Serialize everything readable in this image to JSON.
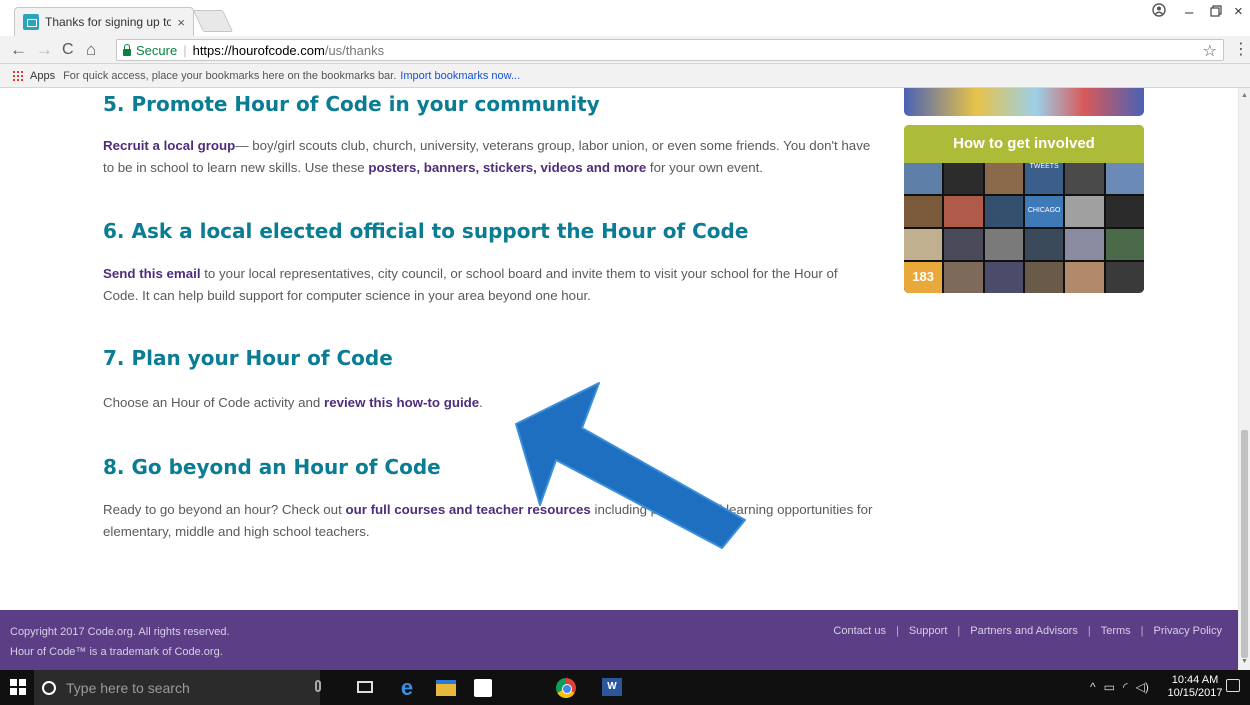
{
  "browser": {
    "tab_title": "Thanks for signing up to",
    "tab_close": "×",
    "omnibox": {
      "secure_label": "Secure",
      "url_host": "https://hourofcode.com",
      "url_path": "/us/thanks"
    },
    "bookmarks_bar": {
      "apps_label": "Apps",
      "hint_text": "For quick access, place your bookmarks here on the bookmarks bar.",
      "import_link": "Import bookmarks now..."
    }
  },
  "steps": [
    {
      "heading": "5. Promote Hour of Code in your community",
      "parts": [
        {
          "t": "Recruit a local group",
          "b": true
        },
        {
          "t": "— boy/girl scouts club, church, university, veterans group, labor union, or even some friends. You don't have to be in school to learn new skills. Use these ",
          "b": false
        },
        {
          "t": "posters, banners, stickers, videos and more",
          "b": true
        },
        {
          "t": " for your own event.",
          "b": false
        }
      ]
    },
    {
      "heading": "6. Ask a local elected official to support the Hour of Code",
      "parts": [
        {
          "t": "Send this email",
          "b": true
        },
        {
          "t": " to your local representatives, city council, or school board and invite them to visit your school for the Hour of Code. It can help build support for computer science in your area beyond one hour.",
          "b": false
        }
      ]
    },
    {
      "heading": "7. Plan your Hour of Code",
      "parts": [
        {
          "t": "Choose an Hour of Code activity and ",
          "b": false
        },
        {
          "t": "review this how-to guide",
          "b": true
        },
        {
          "t": ".",
          "b": false
        }
      ]
    },
    {
      "heading": "8. Go beyond an Hour of Code",
      "parts": [
        {
          "t": "Ready to go beyond an hour? Check out ",
          "b": false
        },
        {
          "t": "our full courses and teacher resources",
          "b": true
        },
        {
          "t": " including professional learning opportunities for elementary, middle and high school teachers.",
          "b": false
        }
      ]
    }
  ],
  "sidebar": {
    "card_title": "How to get involved",
    "tile_labels": [
      "TWEETS",
      "CHICAGO",
      "183"
    ]
  },
  "footer": {
    "copyright": "Copyright 2017 Code.org. All rights reserved.",
    "trademark": "Hour of Code™ is a trademark of Code.org.",
    "links": [
      "Contact us",
      "Support",
      "Partners and Advisors",
      "Terms",
      "Privacy Policy"
    ]
  },
  "taskbar": {
    "search_placeholder": "Type here to search",
    "time": "10:44 AM",
    "date": "10/15/2017"
  },
  "colors": {
    "heading": "#0a7c93",
    "link": "#4e2d7b",
    "footer": "#5b3e86",
    "arrow": "#1f6fc1"
  }
}
